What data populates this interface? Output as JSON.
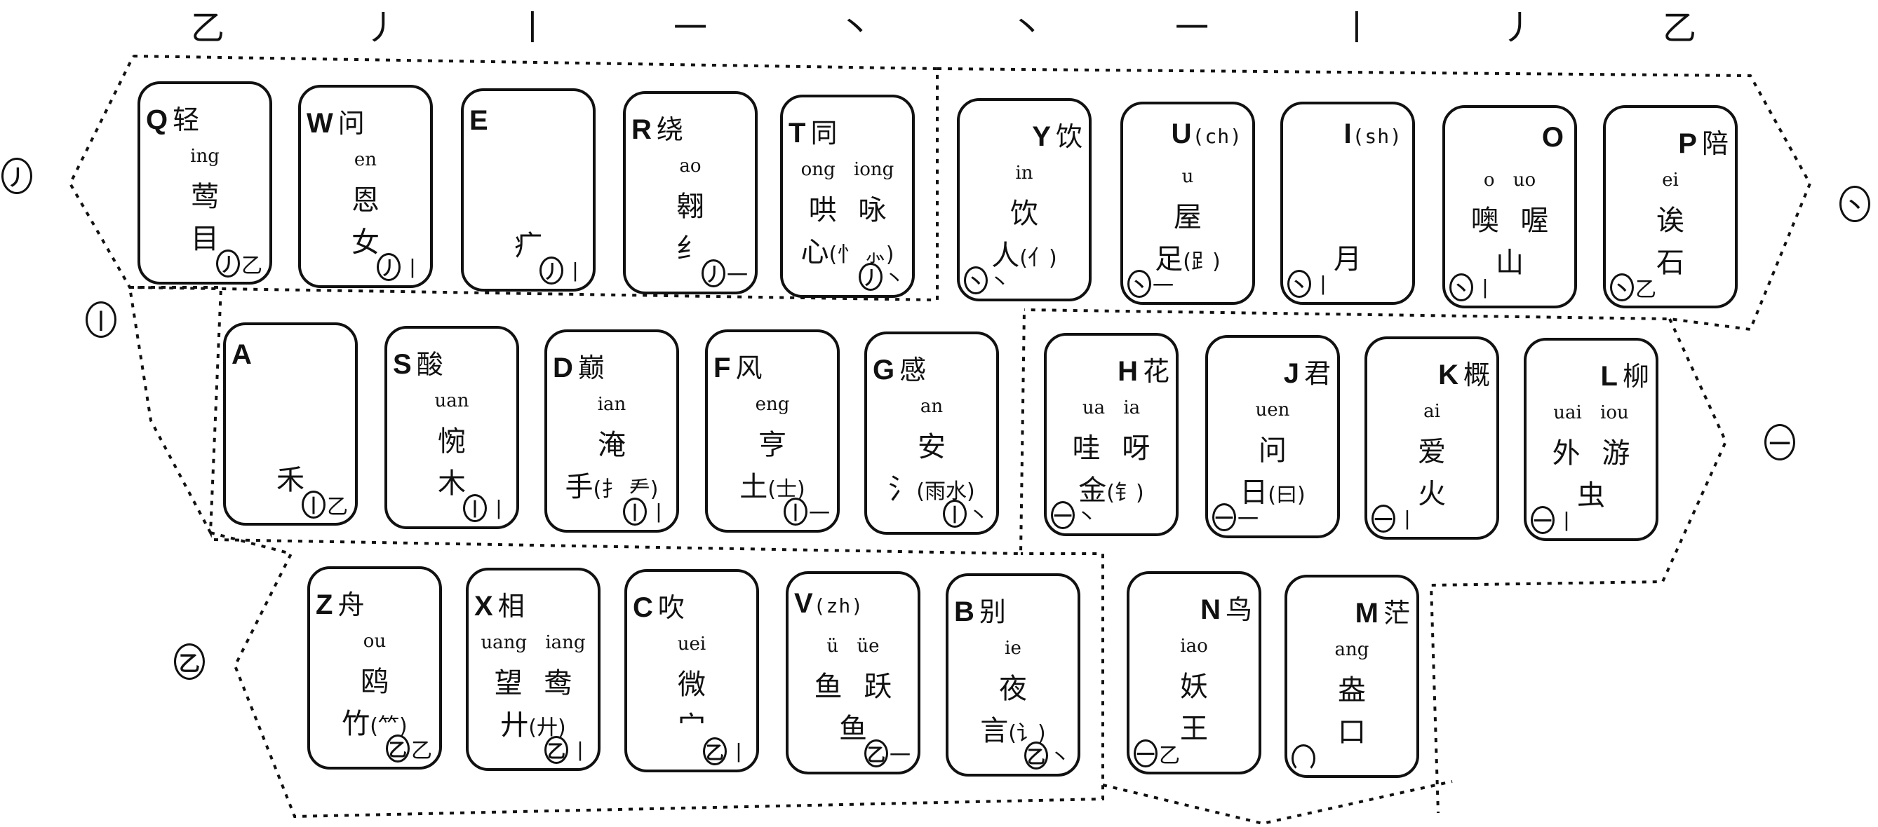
{
  "stroke_header": [
    "乙",
    "丿",
    "丨",
    "一",
    "丶",
    "丶",
    "一",
    "丨",
    "丿",
    "乙"
  ],
  "regions": {
    "left": [
      {
        "name": "pie-region",
        "symbol": "丿"
      },
      {
        "name": "shu-region",
        "symbol": "丨"
      },
      {
        "name": "zhe-region",
        "symbol": "乙"
      }
    ],
    "right": [
      {
        "name": "dian-region",
        "symbol": "丶"
      },
      {
        "name": "heng-region",
        "symbol": "一"
      }
    ]
  },
  "keys": [
    {
      "letter": "Q",
      "hanzi": "轻",
      "sub": "",
      "pinyin": "ing",
      "example": "莺",
      "radical": "目",
      "radical_paren": "",
      "code_circle": "丿",
      "code_stroke": "乙",
      "align": "left"
    },
    {
      "letter": "W",
      "hanzi": "问",
      "sub": "",
      "pinyin": "en",
      "example": "恩",
      "radical": "女",
      "radical_paren": "",
      "code_circle": "丿",
      "code_stroke": "丨",
      "align": "left"
    },
    {
      "letter": "E",
      "hanzi": "",
      "sub": "",
      "pinyin": "",
      "example": "",
      "radical": "疒",
      "radical_paren": "",
      "code_circle": "丿",
      "code_stroke": "丨",
      "align": "left"
    },
    {
      "letter": "R",
      "hanzi": "绕",
      "sub": "",
      "pinyin": "ao",
      "example": "翱",
      "radical": "纟",
      "radical_paren": "",
      "code_circle": "丿",
      "code_stroke": "一",
      "align": "left"
    },
    {
      "letter": "T",
      "hanzi": "同",
      "sub": "",
      "pinyin": "ong iong",
      "example": "哄 咏",
      "radical": "心",
      "radical_paren": "(忄 ⺗)",
      "code_circle": "丿",
      "code_stroke": "丶",
      "align": "left"
    },
    {
      "letter": "Y",
      "hanzi": "饮",
      "sub": "",
      "pinyin": "in",
      "example": "饮",
      "radical": "人",
      "radical_paren": "(亻)",
      "code_circle": "丶",
      "code_stroke": "丶",
      "align": "right"
    },
    {
      "letter": "U",
      "hanzi": "",
      "sub": "(ch)",
      "pinyin": "u",
      "example": "屋",
      "radical": "足",
      "radical_paren": "(⻊)",
      "code_circle": "丶",
      "code_stroke": "一",
      "align": "right"
    },
    {
      "letter": "I",
      "hanzi": "",
      "sub": "(sh)",
      "pinyin": "",
      "example": "",
      "radical": "月",
      "radical_paren": "",
      "code_circle": "丶",
      "code_stroke": "丨",
      "align": "right"
    },
    {
      "letter": "O",
      "hanzi": "",
      "sub": "",
      "pinyin": "o uo",
      "example": "噢 喔",
      "radical": "山",
      "radical_paren": "",
      "code_circle": "丶",
      "code_stroke": "丨",
      "align": "right"
    },
    {
      "letter": "P",
      "hanzi": "陪",
      "sub": "",
      "pinyin": "ei",
      "example": "诶",
      "radical": "石",
      "radical_paren": "",
      "code_circle": "丶",
      "code_stroke": "乙",
      "align": "right"
    },
    {
      "letter": "A",
      "hanzi": "",
      "sub": "",
      "pinyin": "",
      "example": "",
      "radical": "禾",
      "radical_paren": "",
      "code_circle": "丨",
      "code_stroke": "乙",
      "align": "left"
    },
    {
      "letter": "S",
      "hanzi": "酸",
      "sub": "",
      "pinyin": "uan",
      "example": "惋",
      "radical": "木",
      "radical_paren": "",
      "code_circle": "丨",
      "code_stroke": "丨",
      "align": "left"
    },
    {
      "letter": "D",
      "hanzi": "巅",
      "sub": "",
      "pinyin": "ian",
      "example": "淹",
      "radical": "手",
      "radical_paren": "(扌 龵)",
      "code_circle": "丨",
      "code_stroke": "丨",
      "align": "left"
    },
    {
      "letter": "F",
      "hanzi": "风",
      "sub": "",
      "pinyin": "eng",
      "example": "亨",
      "radical": "土",
      "radical_paren": "(士)",
      "code_circle": "丨",
      "code_stroke": "一",
      "align": "left"
    },
    {
      "letter": "G",
      "hanzi": "感",
      "sub": "",
      "pinyin": "an",
      "example": "安",
      "radical": "氵",
      "radical_paren": "(雨水)",
      "code_circle": "丨",
      "code_stroke": "丶",
      "align": "left"
    },
    {
      "letter": "H",
      "hanzi": "花",
      "sub": "",
      "pinyin": "ua ia",
      "example": "哇 呀",
      "radical": "金",
      "radical_paren": "(钅)",
      "code_circle": "一",
      "code_stroke": "丶",
      "align": "right"
    },
    {
      "letter": "J",
      "hanzi": "君",
      "sub": "",
      "pinyin": "uen",
      "example": "问",
      "radical": "日",
      "radical_paren": "(曰)",
      "code_circle": "一",
      "code_stroke": "一",
      "align": "right"
    },
    {
      "letter": "K",
      "hanzi": "概",
      "sub": "",
      "pinyin": "ai",
      "example": "爱",
      "radical": "火",
      "radical_paren": "",
      "code_circle": "一",
      "code_stroke": "丨",
      "align": "right"
    },
    {
      "letter": "L",
      "hanzi": "柳",
      "sub": "",
      "pinyin": "uai iou",
      "example": "外 游",
      "radical": "虫",
      "radical_paren": "",
      "code_circle": "一",
      "code_stroke": "丨",
      "align": "right"
    },
    {
      "letter": "Z",
      "hanzi": "舟",
      "sub": "",
      "pinyin": "ou",
      "example": "鸥",
      "radical": "竹",
      "radical_paren": "(⺮)",
      "code_circle": "乙",
      "code_stroke": "乙",
      "align": "left"
    },
    {
      "letter": "X",
      "hanzi": "相",
      "sub": "",
      "pinyin": "uang iang",
      "example": "望 鸯",
      "radical": "廾",
      "radical_paren": "(廾)",
      "code_circle": "乙",
      "code_stroke": "丨",
      "align": "left"
    },
    {
      "letter": "C",
      "hanzi": "吹",
      "sub": "",
      "pinyin": "uei",
      "example": "微",
      "radical": "宀",
      "radical_paren": "",
      "code_circle": "乙",
      "code_stroke": "丨",
      "align": "left"
    },
    {
      "letter": "V",
      "hanzi": "",
      "sub": "(zh)",
      "pinyin": "ü üe",
      "example": "鱼 跃",
      "radical": "鱼",
      "radical_paren": "",
      "code_circle": "乙",
      "code_stroke": "一",
      "align": "left"
    },
    {
      "letter": "B",
      "hanzi": "别",
      "sub": "",
      "pinyin": "ie",
      "example": "夜",
      "radical": "言",
      "radical_paren": "(讠)",
      "code_circle": "乙",
      "code_stroke": "丶",
      "align": "left"
    },
    {
      "letter": "N",
      "hanzi": "鸟",
      "sub": "",
      "pinyin": "iao",
      "example": "妖",
      "radical": "王",
      "radical_paren": "",
      "code_circle": "一",
      "code_stroke": "乙",
      "align": "right"
    },
    {
      "letter": "M",
      "hanzi": "茫",
      "sub": "",
      "pinyin": "ang",
      "example": "盎",
      "radical": "口",
      "radical_paren": "",
      "code_circle": "",
      "code_stroke": "",
      "align": "right"
    }
  ]
}
